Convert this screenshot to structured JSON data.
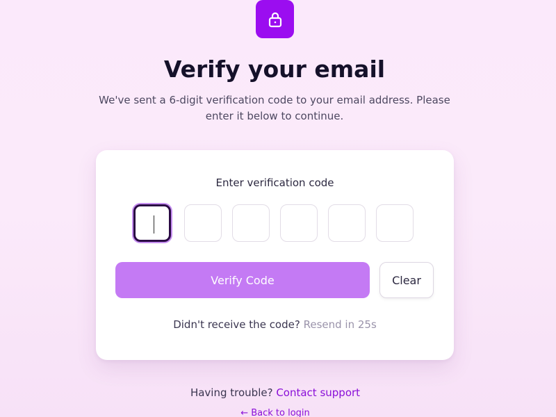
{
  "header": {
    "icon": "lock-icon",
    "title": "Verify your email",
    "subtitle": "We've sent a 6-digit verification code to your email address. Please enter it below to continue."
  },
  "card": {
    "label": "Enter verification code",
    "code_digits": [
      "",
      "",
      "",
      "",
      "",
      ""
    ],
    "active_index": 0,
    "verify_label": "Verify Code",
    "clear_label": "Clear",
    "resend_prompt": "Didn't receive the code?",
    "resend_timer": "Resend in 25s"
  },
  "footer": {
    "trouble_text": "Having trouble?",
    "support_link": "Contact support",
    "back_link": "← Back to login"
  },
  "colors": {
    "accent": "#9b0df0",
    "button_disabled": "#c47af4",
    "link": "#8a0fd8"
  }
}
